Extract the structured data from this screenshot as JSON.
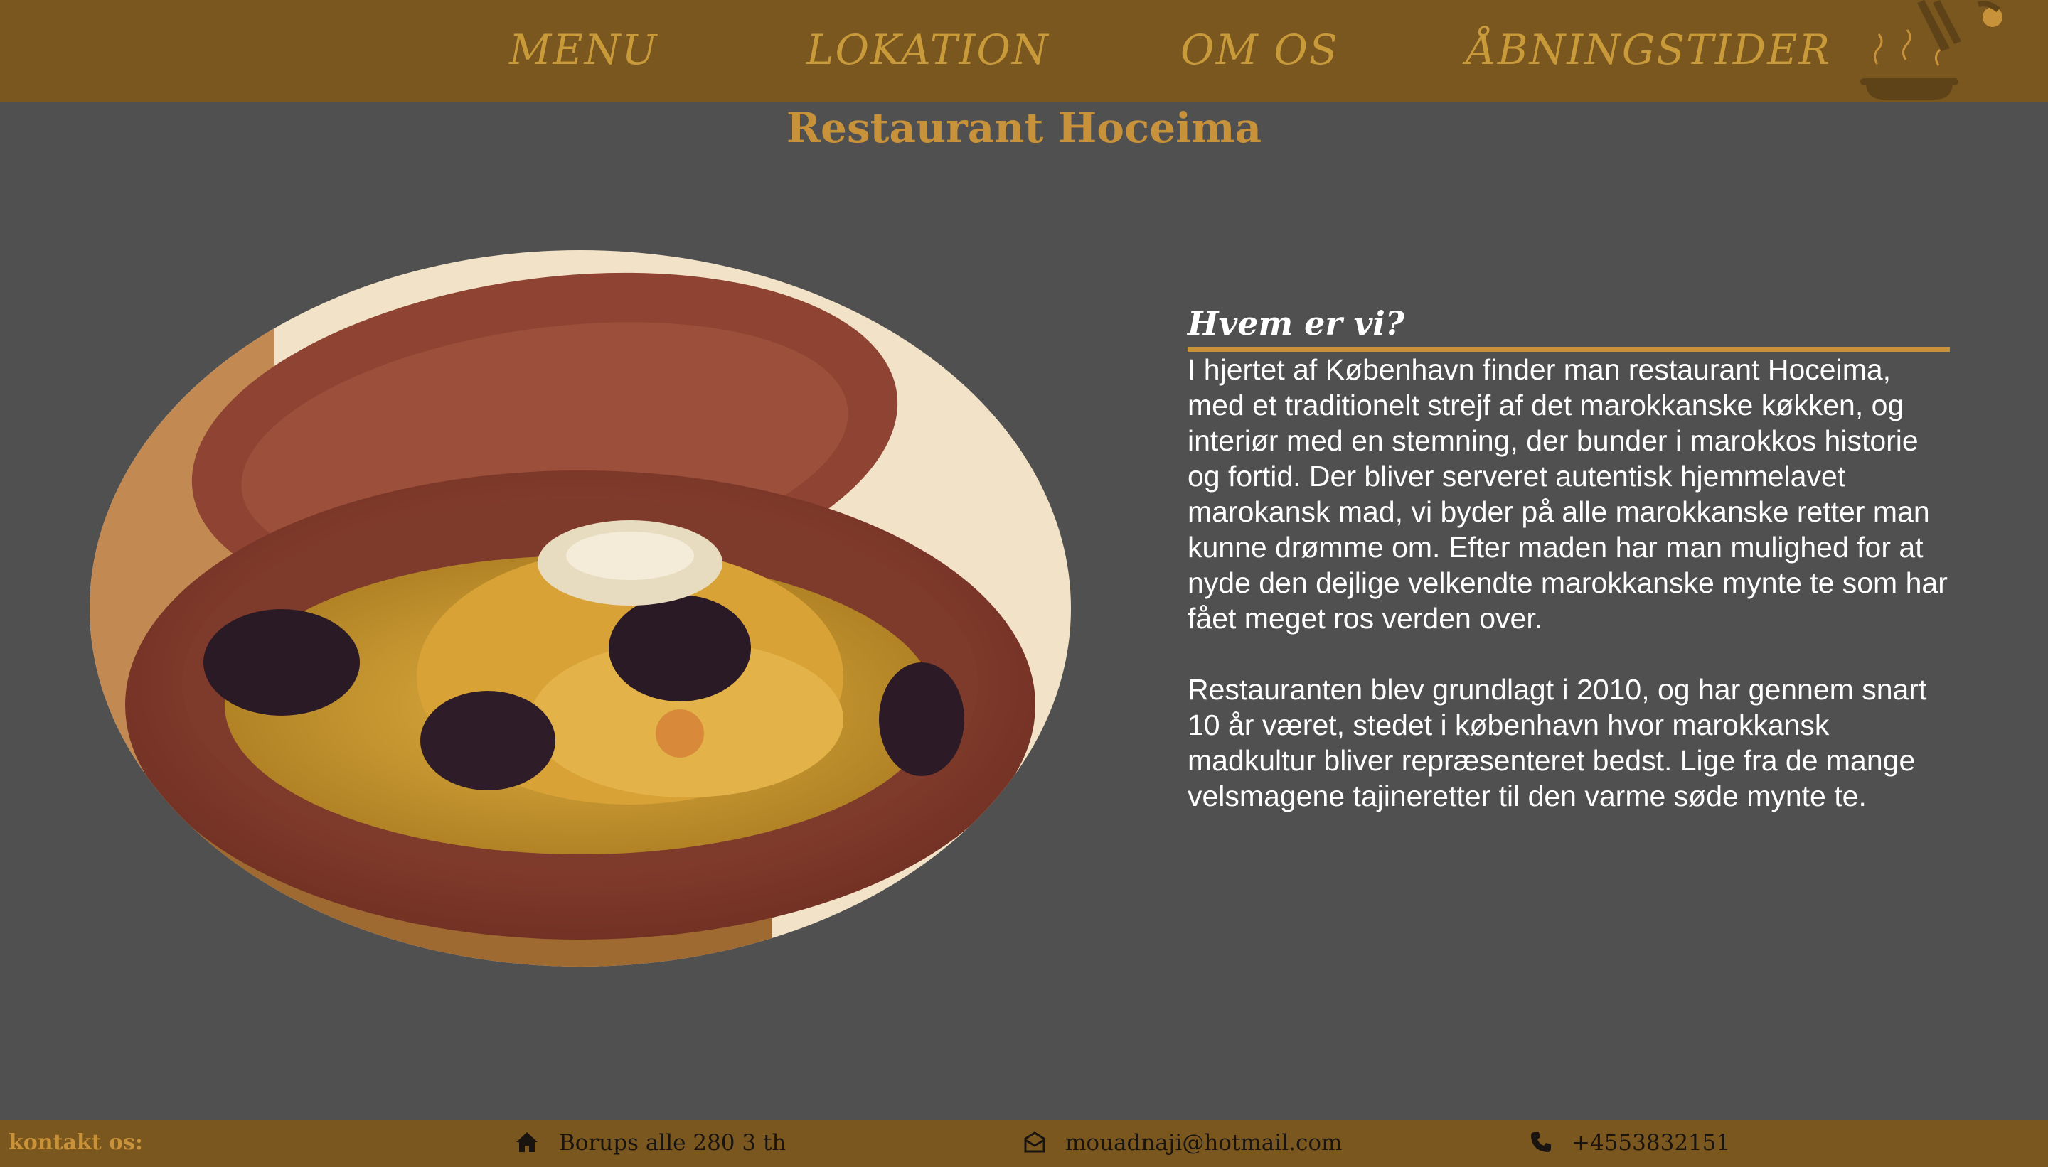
{
  "nav": {
    "items": [
      {
        "label": "MENU"
      },
      {
        "label": "LOKATION"
      },
      {
        "label": "OM OS"
      },
      {
        "label": "ÅBNINGSTIDER"
      }
    ],
    "logo_icon": "tagine-steam-icon"
  },
  "page": {
    "title": "Restaurant Hoceima"
  },
  "hero": {
    "icon": "tagine-dish-photo"
  },
  "about": {
    "title": "Hvem er vi?",
    "paragraphs": [
      "I hjertet af København finder man restaurant Hoceima, med et traditionelt strejf af det marokkanske køkken, og interiør med en stemning, der bunder i marokkos historie og fortid. Der bliver serveret autentisk hjemmelavet marokansk mad, vi byder på alle marokkanske retter man kunne drømme om. Efter maden har man mulighed for at nyde den dejlige velkendte marokkanske mynte te som har fået meget ros verden over.",
      "Restauranten blev grundlagt i 2010, og har gennem snart 10 år været, stedet i københavn hvor marokkansk madkultur bliver repræsenteret bedst. Lige fra de mange velsmagene tajineretter til den varme søde mynte te."
    ]
  },
  "footer": {
    "label": "kontakt os:",
    "address": "Borups alle 280 3 th",
    "email": "mouadnaji@hotmail.com",
    "phone": "+4553832151",
    "icons": {
      "address": "home-icon",
      "email": "envelope-icon",
      "phone": "phone-icon"
    }
  },
  "colors": {
    "header_bg": "#7a571f",
    "accent": "#c8923a",
    "page_bg": "#505050",
    "text": "#ffffff"
  }
}
